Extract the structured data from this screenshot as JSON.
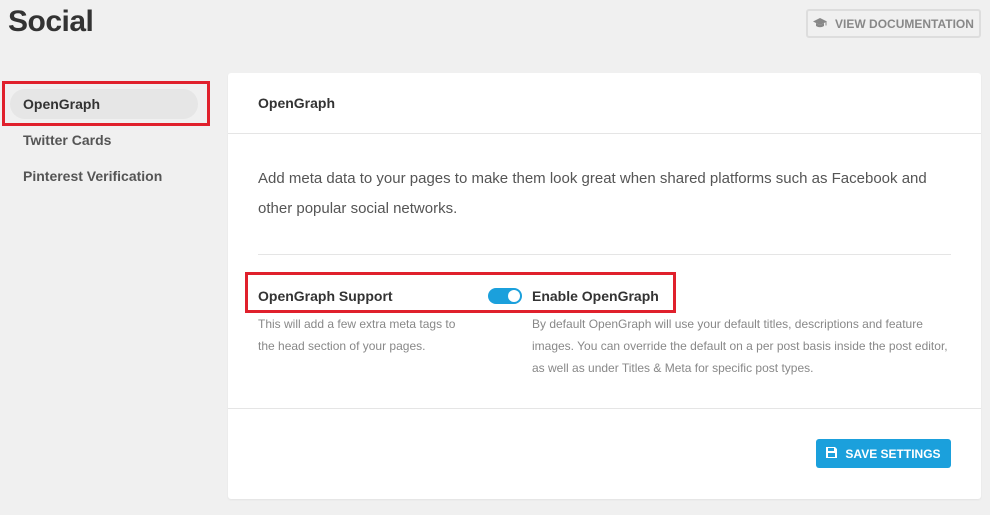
{
  "page": {
    "title": "Social"
  },
  "header": {
    "doc_button_label": "VIEW DOCUMENTATION",
    "doc_icon": "graduation-cap-icon"
  },
  "sidebar": {
    "items": [
      {
        "label": "OpenGraph",
        "active": true
      },
      {
        "label": "Twitter Cards",
        "active": false
      },
      {
        "label": "Pinterest Verification",
        "active": false
      }
    ]
  },
  "panel": {
    "title": "OpenGraph",
    "description": "Add meta data to your pages to make them look great when shared platforms such as Facebook and other popular social networks.",
    "setting": {
      "label": "OpenGraph Support",
      "help": "This will add a few extra meta tags to the head section of your pages.",
      "toggle_label": "Enable OpenGraph",
      "toggle_on": true,
      "toggle_help": "By default OpenGraph will use your default titles, descriptions and feature images. You can override the default on a per post basis inside the post editor, as well as under Titles & Meta for specific post types."
    },
    "save_button_label": "SAVE SETTINGS",
    "save_icon": "floppy-disk-icon"
  },
  "colors": {
    "accent": "#1ba0dc",
    "highlight": "#e0202c",
    "background": "#f0f0f0"
  }
}
